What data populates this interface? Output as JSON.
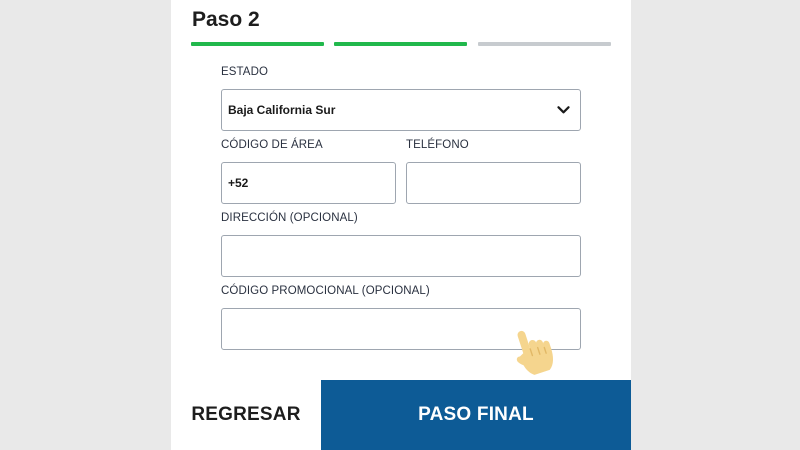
{
  "step": {
    "title": "Paso 2",
    "total_segments": 3,
    "completed_segments": 2
  },
  "colors": {
    "progress_done": "#21b84c",
    "progress_todo": "#c7cbcf",
    "primary_button": "#0d5b96",
    "hand_fill": "#f5d58e",
    "hand_shade": "#e2b866"
  },
  "form": {
    "estado": {
      "label": "ESTADO",
      "value": "Baja California Sur"
    },
    "codigo_area": {
      "label": "CÓDIGO DE ÁREA",
      "value": "+52"
    },
    "telefono": {
      "label": "TELÉFONO",
      "value": ""
    },
    "direccion": {
      "label": "DIRECCIÓN (OPCIONAL)",
      "value": ""
    },
    "codigo_promocional": {
      "label": "CÓDIGO PROMOCIONAL (OPCIONAL)",
      "value": ""
    }
  },
  "buttons": {
    "back": "REGRESAR",
    "final": "PASO FINAL"
  },
  "icons": {
    "dropdown": "chevron-down-icon",
    "pointer": "pointing-hand-icon"
  }
}
